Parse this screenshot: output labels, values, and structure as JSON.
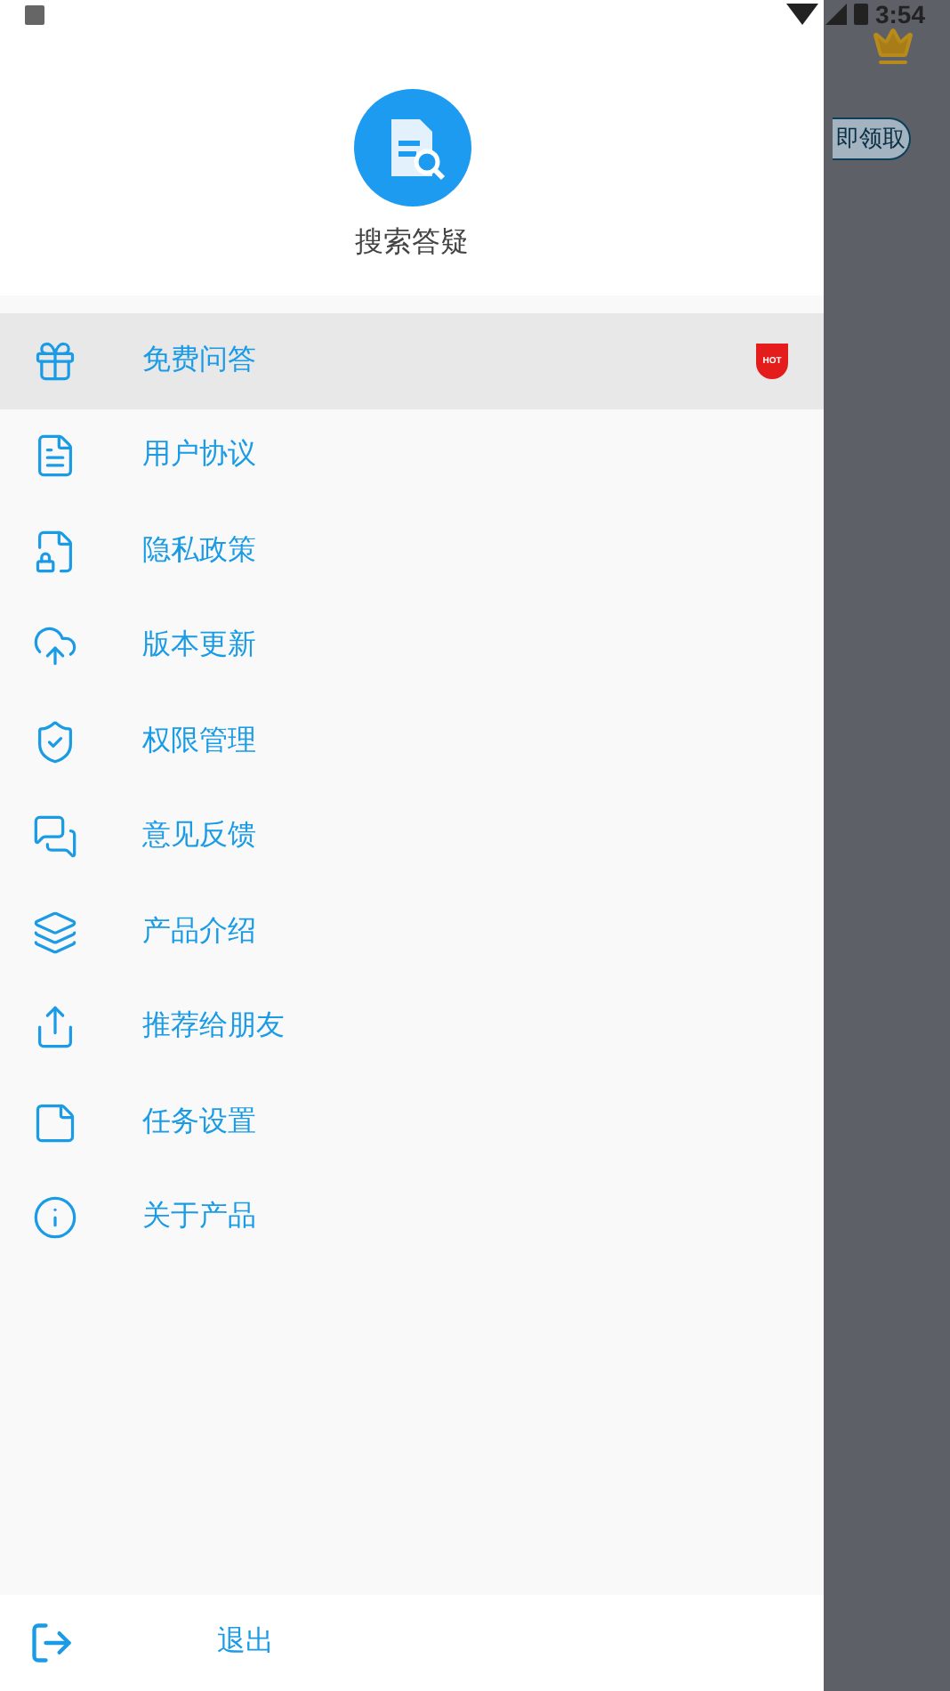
{
  "status_bar": {
    "time": "3:54"
  },
  "drawer": {
    "app_name": "搜索答疑",
    "items": [
      {
        "label": "免费问答",
        "selected": true,
        "badge": "HOT"
      },
      {
        "label": "用户协议",
        "selected": false
      },
      {
        "label": "隐私政策",
        "selected": false
      },
      {
        "label": "版本更新",
        "selected": false
      },
      {
        "label": "权限管理",
        "selected": false
      },
      {
        "label": "意见反馈",
        "selected": false
      },
      {
        "label": "产品介绍",
        "selected": false
      },
      {
        "label": "推荐给朋友",
        "selected": false
      },
      {
        "label": "任务设置",
        "selected": false
      },
      {
        "label": "关于产品",
        "selected": false
      }
    ],
    "logout": "退出"
  },
  "background": {
    "claim_button": "即领取"
  }
}
